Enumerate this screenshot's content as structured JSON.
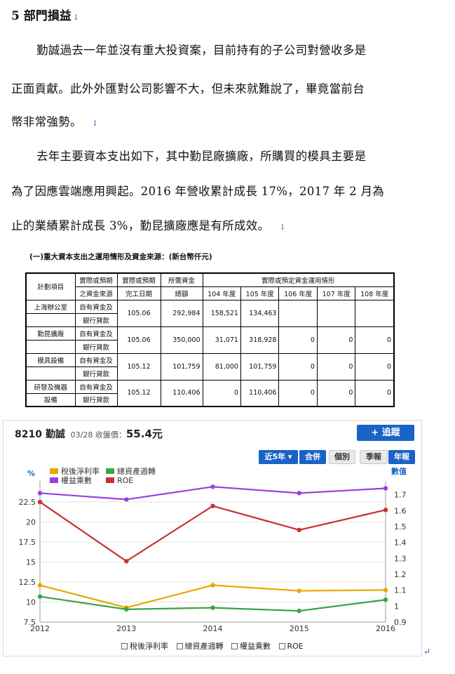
{
  "doc": {
    "heading": "5 部門損益",
    "paragraph_mark": "↓",
    "lines": [
      "勤誠過去一年並沒有重大投資案，目前持有的子公司對營收多是",
      "正面貢獻。此外外匯對公司影響不大，但未來就難說了，畢竟當前台",
      "幣非常強勢。",
      "去年主要資本支出如下，其中勤昆廠擴廠，所購買的模具主要是",
      "為了因應雲端應用興起。2016 年營收累計成長 17%，2017 年 2 月為",
      "止的業績累計成長 3%，勤昆擴廠應是有所成效。"
    ]
  },
  "capex_table": {
    "caption": "(一)重大資本支出之運用情形及資金來源：(新台幣仟元)",
    "headers": {
      "project": "計劃項目",
      "source_l1": "實際或預期",
      "source_l2": "之資金來源",
      "done_l1": "實際或預期",
      "done_l2": "完工日期",
      "need_l1": "所需資金",
      "need_l2": "總額",
      "usage": "實際或預定資金運用情形",
      "years": [
        "104 年度",
        "105 年度",
        "106 年度",
        "107 年度",
        "108 年度"
      ]
    },
    "rows": [
      {
        "project_l1": "上海辦公室",
        "project_l2": "",
        "src_l1": "自有資金及",
        "src_l2": "銀行貸款",
        "done": "105.06",
        "total": "292,984",
        "y104": "158,521",
        "y105": "134,463",
        "y106": "",
        "y107": "",
        "y108": ""
      },
      {
        "project_l1": "勤昆擴廠",
        "project_l2": "",
        "src_l1": "自有資金及",
        "src_l2": "銀行貸款",
        "done": "105.06",
        "total": "350,000",
        "y104": "31,071",
        "y105": "318,928",
        "y106": "0",
        "y107": "0",
        "y108": "0"
      },
      {
        "project_l1": "模具設備",
        "project_l2": "",
        "src_l1": "自有資金及",
        "src_l2": "銀行貸款",
        "done": "105.12",
        "total": "101,759",
        "y104": "81,000",
        "y105": "101,759",
        "y106": "0",
        "y107": "0",
        "y108": "0"
      },
      {
        "project_l1": "研發及機器",
        "project_l2": "設備",
        "src_l1": "自有資金及",
        "src_l2": "銀行貸款",
        "done": "105.12",
        "total": "110,406",
        "y104": "0",
        "y105": "110,406",
        "y106": "0",
        "y107": "0",
        "y108": "0"
      }
    ]
  },
  "chart_widget": {
    "code_name": "8210 勤誠",
    "date_label": "03/28 收盤價：",
    "price": "55.4元",
    "track_button": "+ 追蹤",
    "period_button": "近5年 ▾",
    "merge_button": "合併",
    "single_button": "個別",
    "quarter_button": "季報",
    "annual_button": "年報",
    "bottom_legend": [
      "稅後淨利率",
      "總資產週轉",
      "權益乘數",
      "ROE"
    ],
    "colors": {
      "net_margin": "#e8a800",
      "asset_turnover": "#3aa447",
      "equity_multiplier": "#9b3fe0",
      "roe": "#c83232"
    }
  },
  "chart_data": {
    "type": "line",
    "x": [
      "2012",
      "2013",
      "2014",
      "2015",
      "2016"
    ],
    "left_axis_label": "%",
    "right_axis_label": "數值",
    "left_ticks": [
      "7.5",
      "10",
      "12.5",
      "15",
      "17.5",
      "20",
      "22.5"
    ],
    "right_ticks": [
      "0.9",
      "1",
      "1.1",
      "1.2",
      "1.3",
      "1.4",
      "1.5",
      "1.6",
      "1.7"
    ],
    "left_ylim": [
      7.5,
      24.6
    ],
    "right_ylim": [
      0.9,
      1.76
    ],
    "grid": true,
    "legend_position": "top-left",
    "series": [
      {
        "name": "稅後淨利率",
        "axis": "left",
        "values": [
          12.1,
          9.3,
          12.1,
          11.4,
          11.5
        ]
      },
      {
        "name": "總資產週轉",
        "axis": "right",
        "values": [
          1.06,
          0.98,
          0.99,
          0.97,
          1.04
        ]
      },
      {
        "name": "權益乘數",
        "axis": "right",
        "values": [
          1.71,
          1.67,
          1.75,
          1.71,
          1.74
        ]
      },
      {
        "name": "ROE",
        "axis": "left",
        "values": [
          22.5,
          15.1,
          22.0,
          19.0,
          21.5
        ]
      }
    ]
  }
}
